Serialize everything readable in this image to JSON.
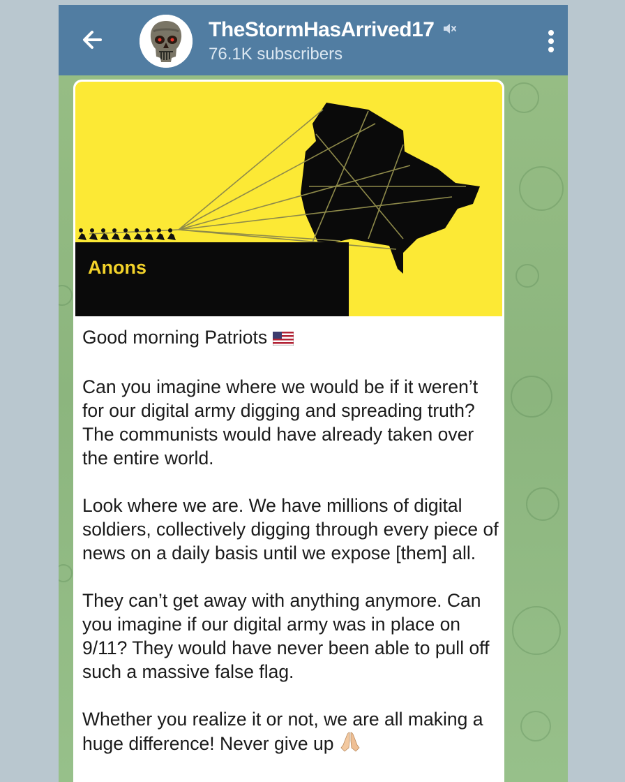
{
  "header": {
    "back_icon": "arrow-left-icon",
    "avatar_icon": "skull-avatar-icon",
    "channel_name": "TheStormHasArrived17",
    "mute_icon": "muted-speaker-icon",
    "subscribers": "76.1K subscribers",
    "menu_icon": "vertical-dots-icon",
    "background_color": "#517da2"
  },
  "post": {
    "image": {
      "caption": "Anons",
      "background_color": "#fce935"
    },
    "paragraphs": [
      {
        "text": "Good morning Patriots",
        "emoji": "us-flag-emoji"
      },
      {
        "text": "Can you imagine where we would be if it weren’t for our digital army digging and spreading truth? The communists would have already taken over the entire world."
      },
      {
        "text": "Look where we are. We have millions of digital soldiers, collectively digging through every piece of news on a daily basis until we expose [them] all."
      },
      {
        "text": "They can’t get away with anything anymore. Can you imagine if our digital army was in place on 9/11? They would have never been able to pull off such a massive false flag."
      },
      {
        "text": "Whether you realize it or not, we are all making a huge difference! Never give up",
        "emoji": "folded-hands-emoji"
      }
    ]
  }
}
